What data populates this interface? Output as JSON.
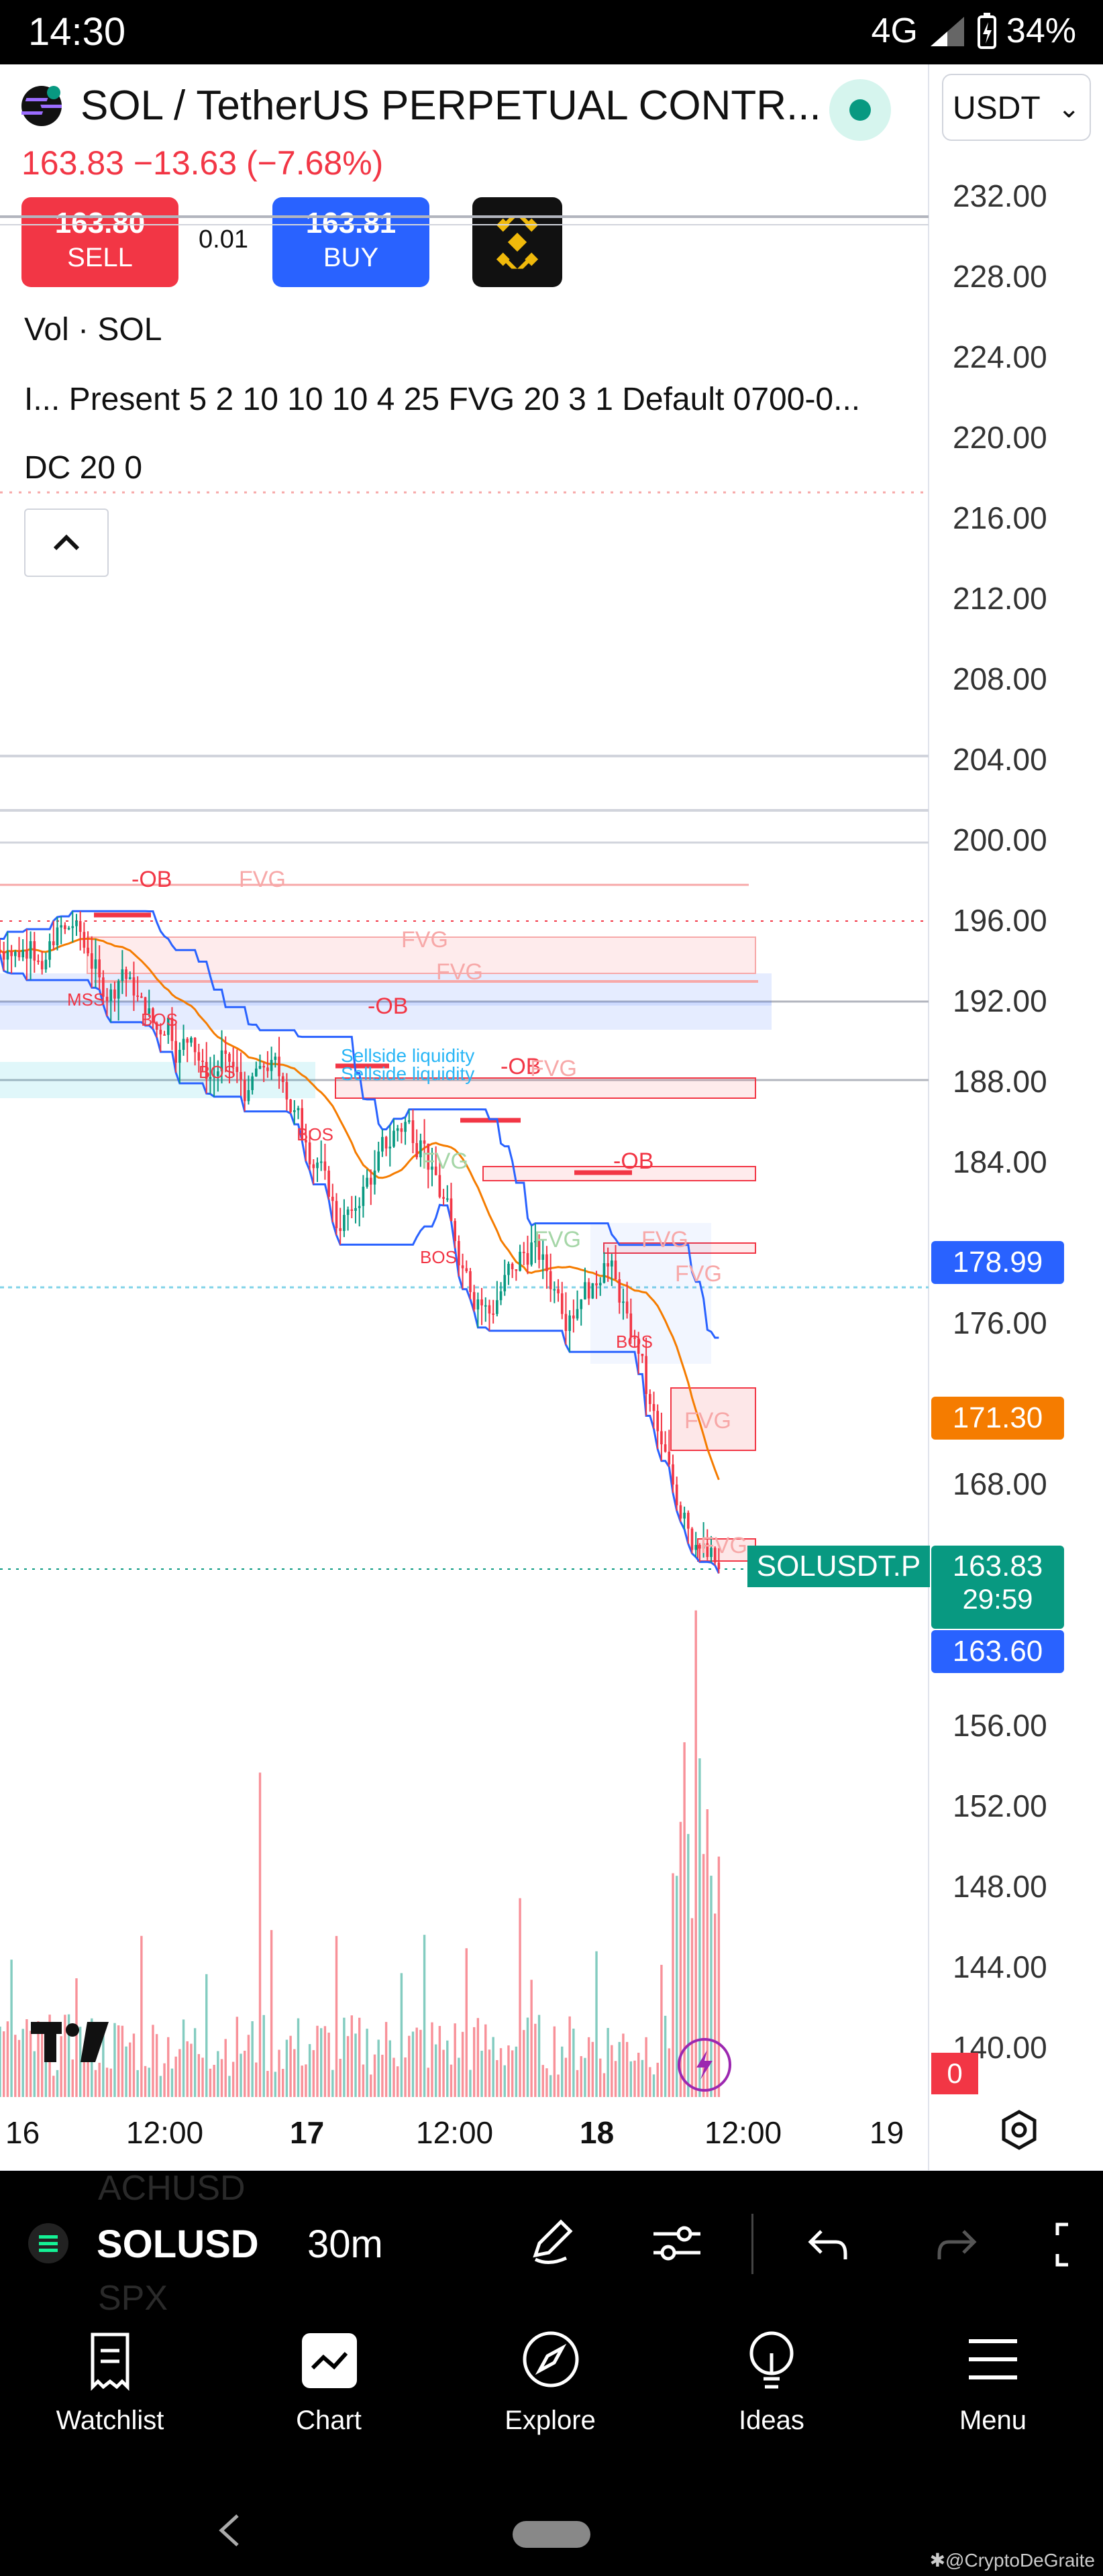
{
  "status_bar": {
    "time": "14:30",
    "network": "4G",
    "battery": "34%"
  },
  "symbol": {
    "title": "SOL / TetherUS PERPETUAL CONTR...",
    "currency": "USDT",
    "price_change": "163.83  −13.63 (−7.68%)"
  },
  "trade": {
    "sell_price": "163.80",
    "sell_label": "SELL",
    "spread": "0.01",
    "buy_price": "163.81",
    "buy_label": "BUY"
  },
  "indicators": [
    "Vol · SOL",
    "I...   Present 5 2 10 10 10 4 25 FVG 20 3 1 Default 0700-0...",
    "DC 20 0"
  ],
  "price_axis": [
    "232.00",
    "228.00",
    "224.00",
    "220.00",
    "216.00",
    "212.00",
    "208.00",
    "204.00",
    "200.00",
    "196.00",
    "192.00",
    "188.00",
    "184.00",
    "176.00",
    "168.00",
    "156.00",
    "152.00",
    "148.00",
    "144.00",
    "140.00"
  ],
  "badges": {
    "blue_upper": "178.99",
    "orange": "171.30",
    "symbol_label": "SOLUSDT.P",
    "last_price": "163.83",
    "countdown": "29:59",
    "blue_lower": "163.60",
    "volume_red": "0"
  },
  "time_axis": [
    "16",
    "12:00",
    "17",
    "12:00",
    "18",
    "12:00",
    "19"
  ],
  "chart_labels": [
    "-OB",
    "FVG",
    "FVG",
    "FVG",
    "-OB",
    "MSS",
    "BOS",
    "BOS",
    "Sellside liquidity",
    "Sellside liquidity",
    "-OB",
    "FVG",
    "BOS",
    "FVG",
    "-OB",
    "FVG",
    "BOS",
    "FVG",
    "BOS",
    "FVG",
    "FVG",
    "FVG"
  ],
  "toolbar": {
    "symbol": "SOLUSDT",
    "interval": "30m",
    "ghost_top": "ACHUSD",
    "ghost_bottom": "SPX"
  },
  "nav": [
    "Watchlist",
    "Chart",
    "Explore",
    "Ideas",
    "Menu"
  ],
  "watermark": "✱@CryptoDeGraite",
  "chart_data": {
    "type": "candlestick",
    "y_range": [
      136,
      234
    ],
    "x_labels": [
      "16",
      "12:00",
      "17",
      "12:00",
      "18",
      "12:00",
      "19"
    ],
    "close_path": [
      194.5,
      194.2,
      195.0,
      193.6,
      194.8,
      195.6,
      196.0,
      194.4,
      193.2,
      192.6,
      193.6,
      192.3,
      191.4,
      190.6,
      191.2,
      189.6,
      190.2,
      189.0,
      188.3,
      189.4,
      188.5,
      187.6,
      188.8,
      189.1,
      188.0,
      186.6,
      185.0,
      184.0,
      182.3,
      180.6,
      181.6,
      182.8,
      183.6,
      184.7,
      185.7,
      186.1,
      185.1,
      183.8,
      182.2,
      180.1,
      178.6,
      177.2,
      176.5,
      177.6,
      178.7,
      179.5,
      180.1,
      178.6,
      177.5,
      176.4,
      177.2,
      178.0,
      179.0,
      178.2,
      176.5,
      174.5,
      172.0,
      170.0,
      168.0,
      166.6,
      165.0,
      164.4,
      163.8
    ],
    "volume_peak": [
      0.62,
      0.31,
      0.38,
      0.93,
      0.55
    ]
  }
}
